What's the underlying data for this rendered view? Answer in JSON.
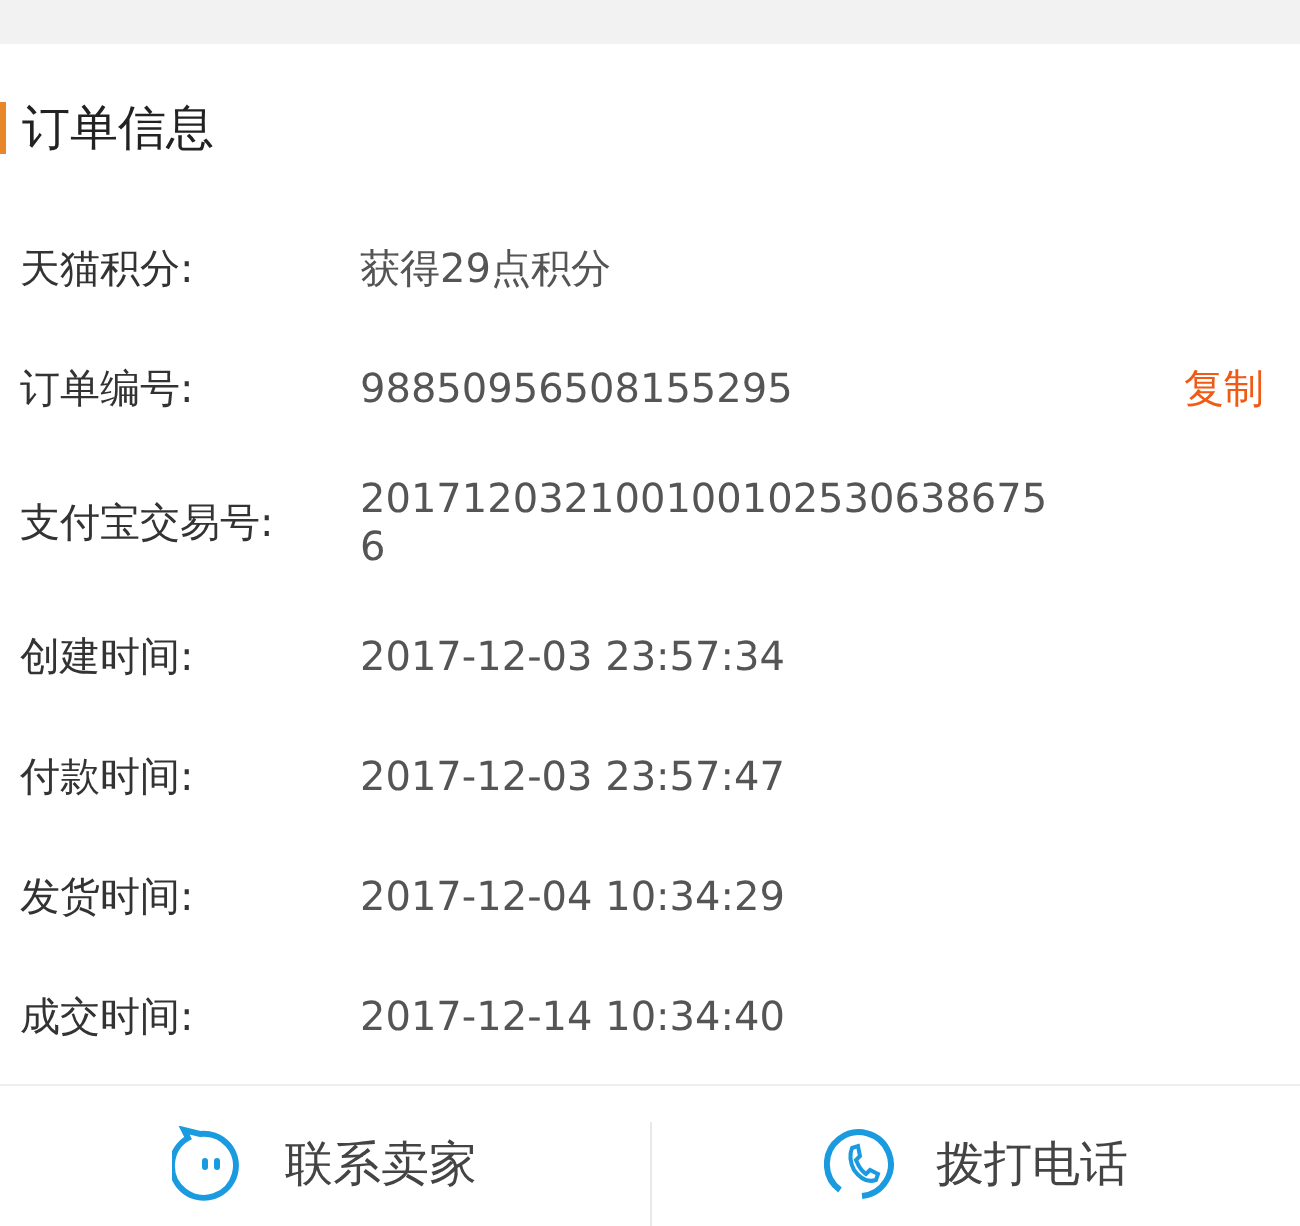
{
  "section": {
    "title": "订单信息"
  },
  "rows": [
    {
      "label": "天猫积分:",
      "value": "获得29点积分"
    },
    {
      "label": "订单编号:",
      "value": "98850956508155295",
      "action": "复制"
    },
    {
      "label": "支付宝交易号:",
      "value": "2017120321001001025306386756"
    },
    {
      "label": "创建时间:",
      "value": "2017-12-03 23:57:34"
    },
    {
      "label": "付款时间:",
      "value": "2017-12-03 23:57:47"
    },
    {
      "label": "发货时间:",
      "value": "2017-12-04 10:34:29"
    },
    {
      "label": "成交时间:",
      "value": "2017-12-14 10:34:40"
    }
  ],
  "actions": [
    {
      "kind": "chat",
      "label": "联系卖家"
    },
    {
      "kind": "phone",
      "label": "拨打电话"
    }
  ]
}
